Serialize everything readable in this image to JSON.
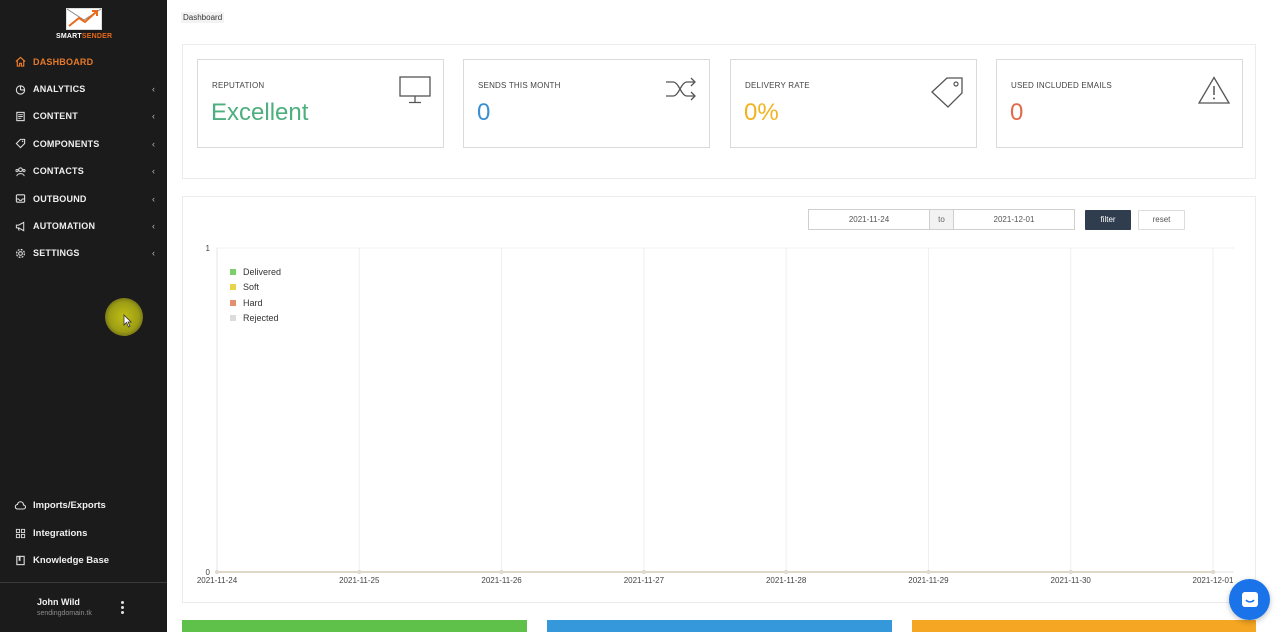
{
  "brand": {
    "name_left": "SMART",
    "name_right": "SENDER"
  },
  "breadcrumb": "Dashboard",
  "sidebar": {
    "items": [
      {
        "label": "DASHBOARD",
        "icon": "home-icon",
        "active": true
      },
      {
        "label": "ANALYTICS",
        "icon": "pie-chart-icon"
      },
      {
        "label": "CONTENT",
        "icon": "file-icon"
      },
      {
        "label": "COMPONENTS",
        "icon": "tag-icon"
      },
      {
        "label": "CONTACTS",
        "icon": "users-icon"
      },
      {
        "label": "OUTBOUND",
        "icon": "inbox-icon"
      },
      {
        "label": "AUTOMATION",
        "icon": "megaphone-icon"
      },
      {
        "label": "SETTINGS",
        "icon": "gear-icon"
      }
    ],
    "bottom_items": [
      {
        "label": "Imports/Exports",
        "icon": "cloud-icon"
      },
      {
        "label": "Integrations",
        "icon": "grid-icon"
      },
      {
        "label": "Knowledge Base",
        "icon": "book-icon"
      }
    ],
    "user": {
      "name": "John Wild",
      "domain": "sendingdomain.tk"
    }
  },
  "stats": [
    {
      "title": "REPUTATION",
      "value": "Excellent",
      "color": "#4caf7d",
      "icon": "monitor-icon"
    },
    {
      "title": "SENDS THIS MONTH",
      "value": "0",
      "color": "#3b8fd1",
      "icon": "shuffle-icon"
    },
    {
      "title": "DELIVERY RATE",
      "value": "0%",
      "color": "#f2b31f",
      "icon": "tag-icon"
    },
    {
      "title": "USED INCLUDED EMAILS",
      "value": "0",
      "color": "#e2694a",
      "icon": "warning-icon"
    }
  ],
  "filter": {
    "from": "2021-11-24",
    "to_label": "to",
    "to": "2021-12-01",
    "filter_label": "filter",
    "reset_label": "reset"
  },
  "chart_data": {
    "type": "line",
    "x": [
      "2021-11-24",
      "2021-11-25",
      "2021-11-26",
      "2021-11-27",
      "2021-11-28",
      "2021-11-29",
      "2021-11-30",
      "2021-12-01"
    ],
    "series": [
      {
        "name": "Delivered",
        "color": "#7ccf6a",
        "values": [
          0,
          0,
          0,
          0,
          0,
          0,
          0,
          0
        ]
      },
      {
        "name": "Soft",
        "color": "#e8d44b",
        "values": [
          0,
          0,
          0,
          0,
          0,
          0,
          0,
          0
        ]
      },
      {
        "name": "Hard",
        "color": "#e39070",
        "values": [
          0,
          0,
          0,
          0,
          0,
          0,
          0,
          0
        ]
      },
      {
        "name": "Rejected",
        "color": "#dcdcdc",
        "values": [
          0,
          0,
          0,
          0,
          0,
          0,
          0,
          0
        ]
      }
    ],
    "ylim": [
      0,
      1
    ],
    "yticks": [
      "0",
      "1"
    ],
    "grid": true,
    "legend": "top-left"
  },
  "bottom_cards": [
    {
      "color": "#5fc04a"
    },
    {
      "color": "#3498db"
    },
    {
      "color": "#f5a623"
    }
  ]
}
